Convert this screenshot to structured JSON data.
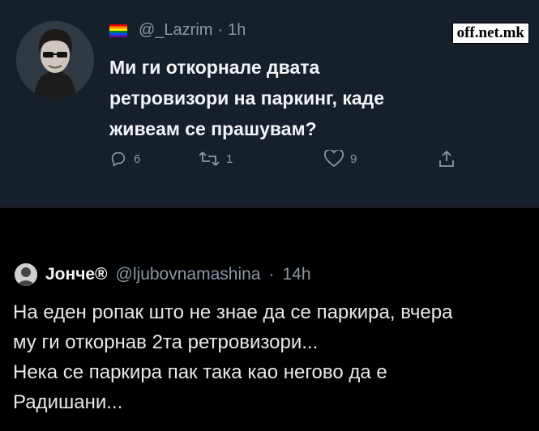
{
  "watermark": "off.net.mk",
  "tweet": {
    "handle": "@_Lazrim",
    "time": "1h",
    "text": "Ми ги откорнале двата ретровизори на паркинг, каде живеам се прашувам?",
    "text_lines": [
      "Ми ги откорнале двата",
      "ретровизори на паркинг, каде",
      "живеам се прашувам?"
    ],
    "actions": {
      "reply": "6",
      "retweet": "1",
      "like": "9"
    },
    "icons": [
      "reply-icon",
      "retweet-icon",
      "like-icon",
      "share-icon"
    ]
  },
  "reply": {
    "name": "Јонче®",
    "handle": "@ljubovnamashina",
    "time": "14h",
    "lines": [
      "На еден ропак што не знае да се паркира, вчера",
      "му ги откорнав 2та ретровизори...",
      "Нека се паркира пак така као негово да е",
      "Радишани..."
    ]
  },
  "colors": {
    "dark_bg": "#15202b",
    "black_bg": "#000000",
    "muted": "#8b98a5",
    "text": "#e7e9ea"
  }
}
